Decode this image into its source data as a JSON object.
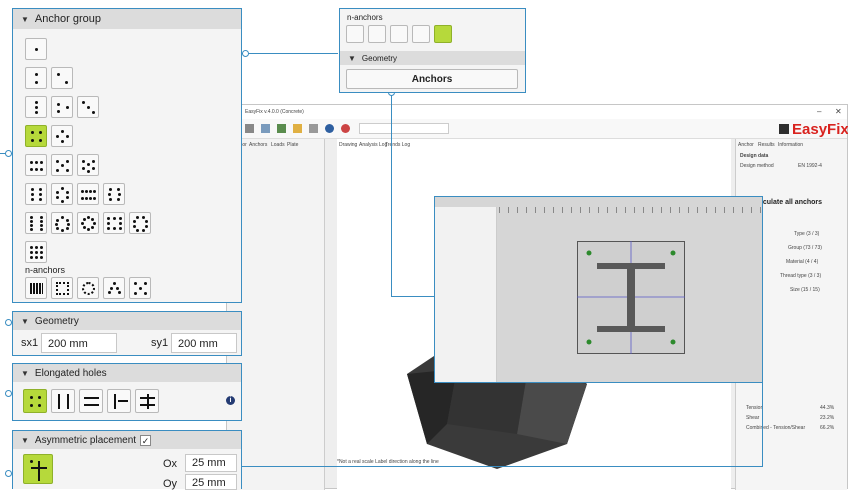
{
  "anchor_group": {
    "title": "Anchor group",
    "n_anchors_label": "n-anchors"
  },
  "top_panel": {
    "n_anchors_label": "n-anchors",
    "geometry_label": "Geometry",
    "anchors_button": "Anchors"
  },
  "geometry": {
    "title": "Geometry",
    "sx1_label": "sx1",
    "sx1_value": "200 mm",
    "sy1_label": "sy1",
    "sy1_value": "200 mm"
  },
  "elongated": {
    "title": "Elongated holes"
  },
  "asym": {
    "title": "Asymmetric placement",
    "ox_label": "Ox",
    "ox_value": "25 mm",
    "oy_label": "Oy",
    "oy_value": "25 mm"
  },
  "app": {
    "title": "EasyFix v.4.0.0 (Concrete)",
    "logo": "EasyFix",
    "tabs": [
      "Anchor",
      "Anchors",
      "Loads",
      "Plate"
    ],
    "view_tabs": [
      "Drawing",
      "Analysis Log",
      "Trends Log"
    ],
    "right_tabs": [
      "Anchor",
      "Results",
      "Information"
    ],
    "design_data": "Design data",
    "design_method_label": "Design method",
    "design_method_value": "EN 1992-4",
    "calculate_label": "Calculate all anchors",
    "footer_note": "*Not a real scale  Label direction along the line",
    "rows": [
      "Type (3 / 3)",
      "Group (73 / 73)",
      "Material (4 / 4)",
      "Thread type (3 / 3)",
      "Size (15 / 15)"
    ],
    "results": [
      {
        "label": "Tension",
        "value": "44.3%"
      },
      {
        "label": "Shear",
        "value": "23.2%"
      },
      {
        "label": "Combined - Tension/Shear",
        "value": "66.2%"
      }
    ]
  },
  "colors": {
    "accent": "#3a8dc1",
    "selected": "#b6d93b",
    "logo_red": "#d9231f"
  }
}
